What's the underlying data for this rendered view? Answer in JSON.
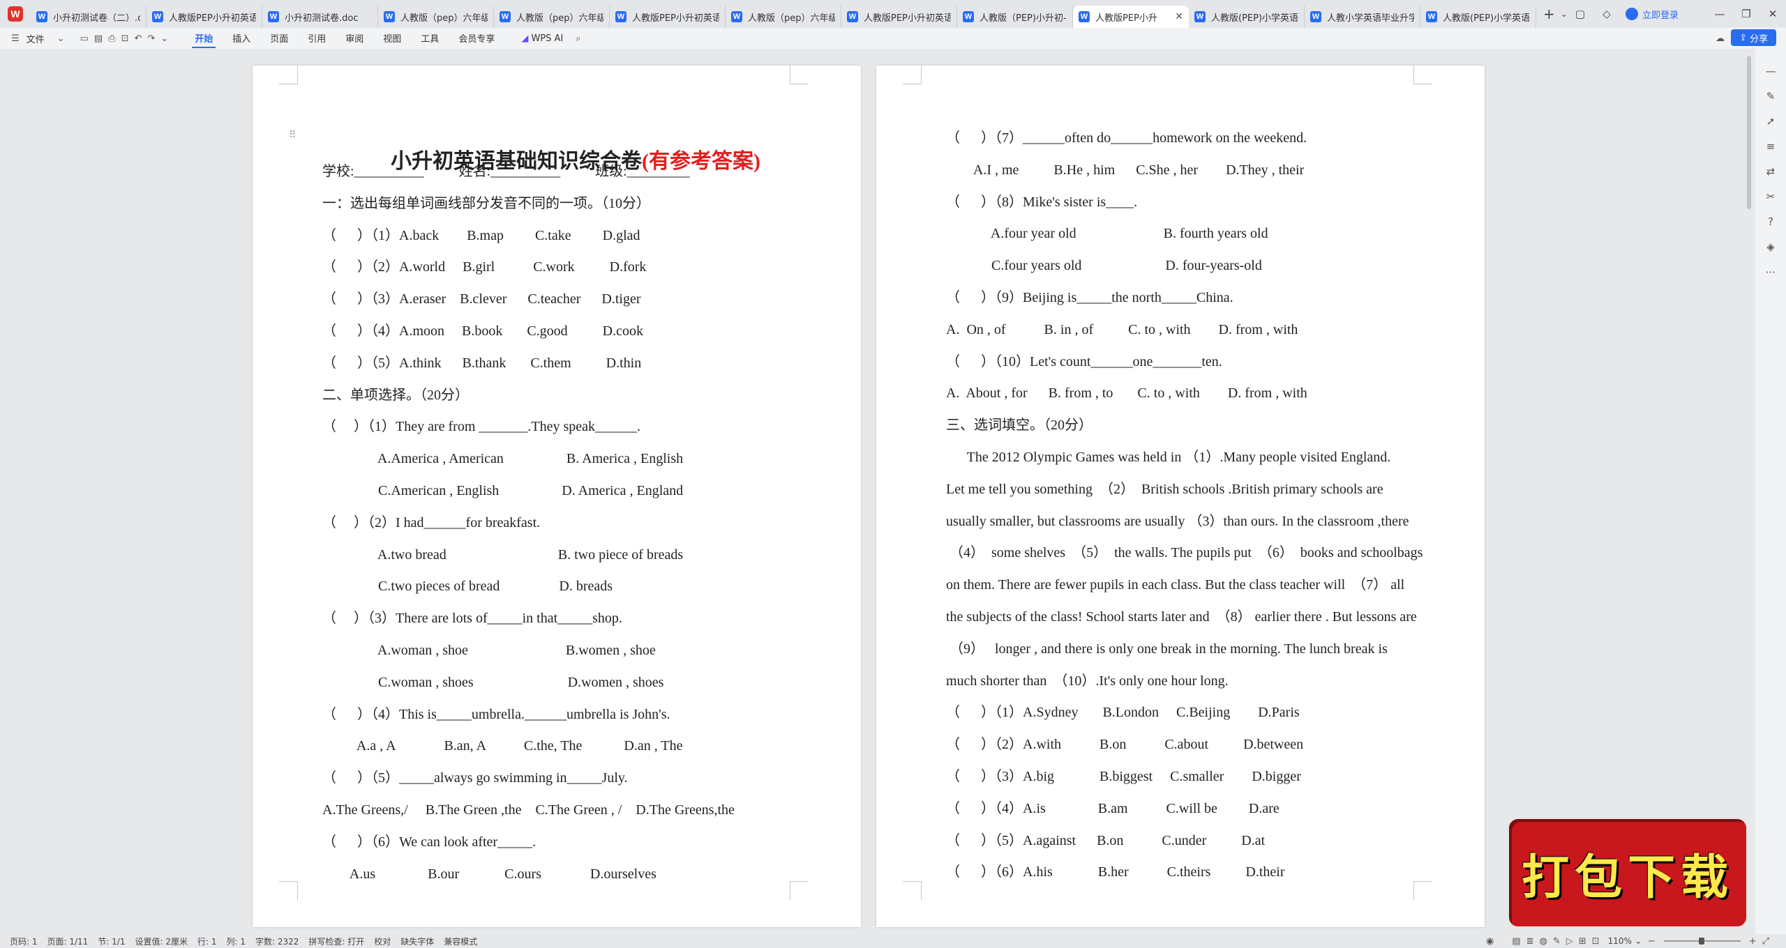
{
  "tabs": [
    {
      "label": "小升初测试卷（二）.d",
      "active": false
    },
    {
      "label": "人教版PEP小升初英语",
      "active": false
    },
    {
      "label": "小升初测试卷.doc",
      "active": false
    },
    {
      "label": "人教版（pep）六年级",
      "active": false
    },
    {
      "label": "人教版（pep）六年级",
      "active": false
    },
    {
      "label": "人教版PEP小升初英语",
      "active": false
    },
    {
      "label": "人教版（pep）六年级",
      "active": false
    },
    {
      "label": "人教版PEP小升初英语",
      "active": false
    },
    {
      "label": "人教版（PEP)小升初-",
      "active": false
    },
    {
      "label": "人教版PEP小升",
      "active": true
    },
    {
      "label": "人教版(PEP)小学英语",
      "active": false
    },
    {
      "label": "人教小学英语毕业升学",
      "active": false
    },
    {
      "label": "人教版(PEP)小学英语",
      "active": false
    }
  ],
  "login_label": "立即登录",
  "menu": {
    "file": "文件",
    "items": [
      "开始",
      "插入",
      "页面",
      "引用",
      "审阅",
      "视图",
      "工具",
      "会员专享"
    ],
    "wps_ai": "WPS AI"
  },
  "share_label": "分享",
  "page1": {
    "title_black": "小升初英语基础知识综合卷",
    "title_red": "(有参考答案)",
    "lines": [
      "学校:__________          姓名:__________          班级:_________",
      "一：选出每组单词画线部分发音不同的一项。（10分）",
      "（      ）（1）A.back        B.map         C.take         D.glad",
      "（      ）（2）A.world     B.girl           C.work          D.fork",
      "（      ）（3）A.eraser    B.clever      C.teacher      D.tiger",
      "（      ）（4）A.moon     B.book       C.good          D.cook",
      "（      ）（5）A.think      B.thank       C.them          D.thin",
      "二、单项选择。（20分）",
      "（     ）（1）They are from _______.They speak______.",
      "                A.America , American                  B. America , English",
      "                C.American , English                  D. America , England",
      "（     ）（2）I had______for breakfast.",
      "                A.two bread                                B. two piece of breads",
      "                C.two pieces of bread                 D. breads",
      "（     ）（3）There are lots of_____in that_____shop.",
      "                A.woman , shoe                            B.women , shoe",
      "                C.woman , shoes                           D.women , shoes",
      "（      ）（4）This is_____umbrella.______umbrella is John's.",
      "          A.a , A              B.an, A           C.the, The            D.an , The",
      "（      ）（5）_____always go swimming in_____July.",
      "A.The Greens,/     B.The Green ,the    C.The Green , /    D.The Greens,the",
      "（      ）（6）We can look after_____.",
      "        A.us               B.our             C.ours              D.ourselves"
    ]
  },
  "page2": {
    "lines": [
      "（      ）（7）______often do______homework on the weekend.",
      "        A.I , me          B.He , him      C.She , her        D.They , their",
      "（      ）（8）Mike's sister is____.",
      "             A.four year old                         B. fourth years old",
      "             C.four years old                        D. four-years-old",
      "（      ）（9）Beijing is_____the north_____China.",
      "A.  On , of           B. in , of          C. to , with        D. from , with",
      "（      ）（10）Let's count______one_______ten.",
      "A.  About , for      B. from , to       C. to , with        D. from , with",
      "三、选词填空。（20分）",
      "      The 2012 Olympic Games was held in （1）.Many people visited England.",
      "Let me tell you something  （2）  British schools .British primary schools are",
      "usually smaller, but classrooms are usually （3）than ours. In the classroom ,there",
      " （4）  some shelves  （5）  the walls. The pupils put  （6）  books and schoolbags",
      "on them. There are fewer pupils in each class. But the class teacher will  （7） all",
      "the subjects of the class! School starts later and  （8） earlier there . But lessons are",
      " （9）   longer , and there is only one break in the morning. The lunch break is",
      "much shorter than  （10）.It's only one hour long.",
      "（      ）（1）A.Sydney       B.London     C.Beijing        D.Paris",
      "（      ）（2）A.with           B.on           C.about          D.between",
      "（      ）（3）A.big             B.biggest     C.smaller        D.bigger",
      "（      ）（4）A.is               B.am           C.will be         D.are",
      "（      ）（5）A.against      B.on           C.under          D.at",
      "（      ）（6）A.his             B.her           C.theirs          D.their"
    ]
  },
  "status": {
    "items": [
      "页码: 1",
      "页面: 1/11",
      "节: 1/1",
      "设置值: 2厘米",
      "行: 1",
      "列: 1",
      "字数: 2322",
      "拼写检查: 打开",
      "校对",
      "缺失字体",
      "兼容模式"
    ],
    "zoom": "110%"
  },
  "promo_text": "打包下载"
}
